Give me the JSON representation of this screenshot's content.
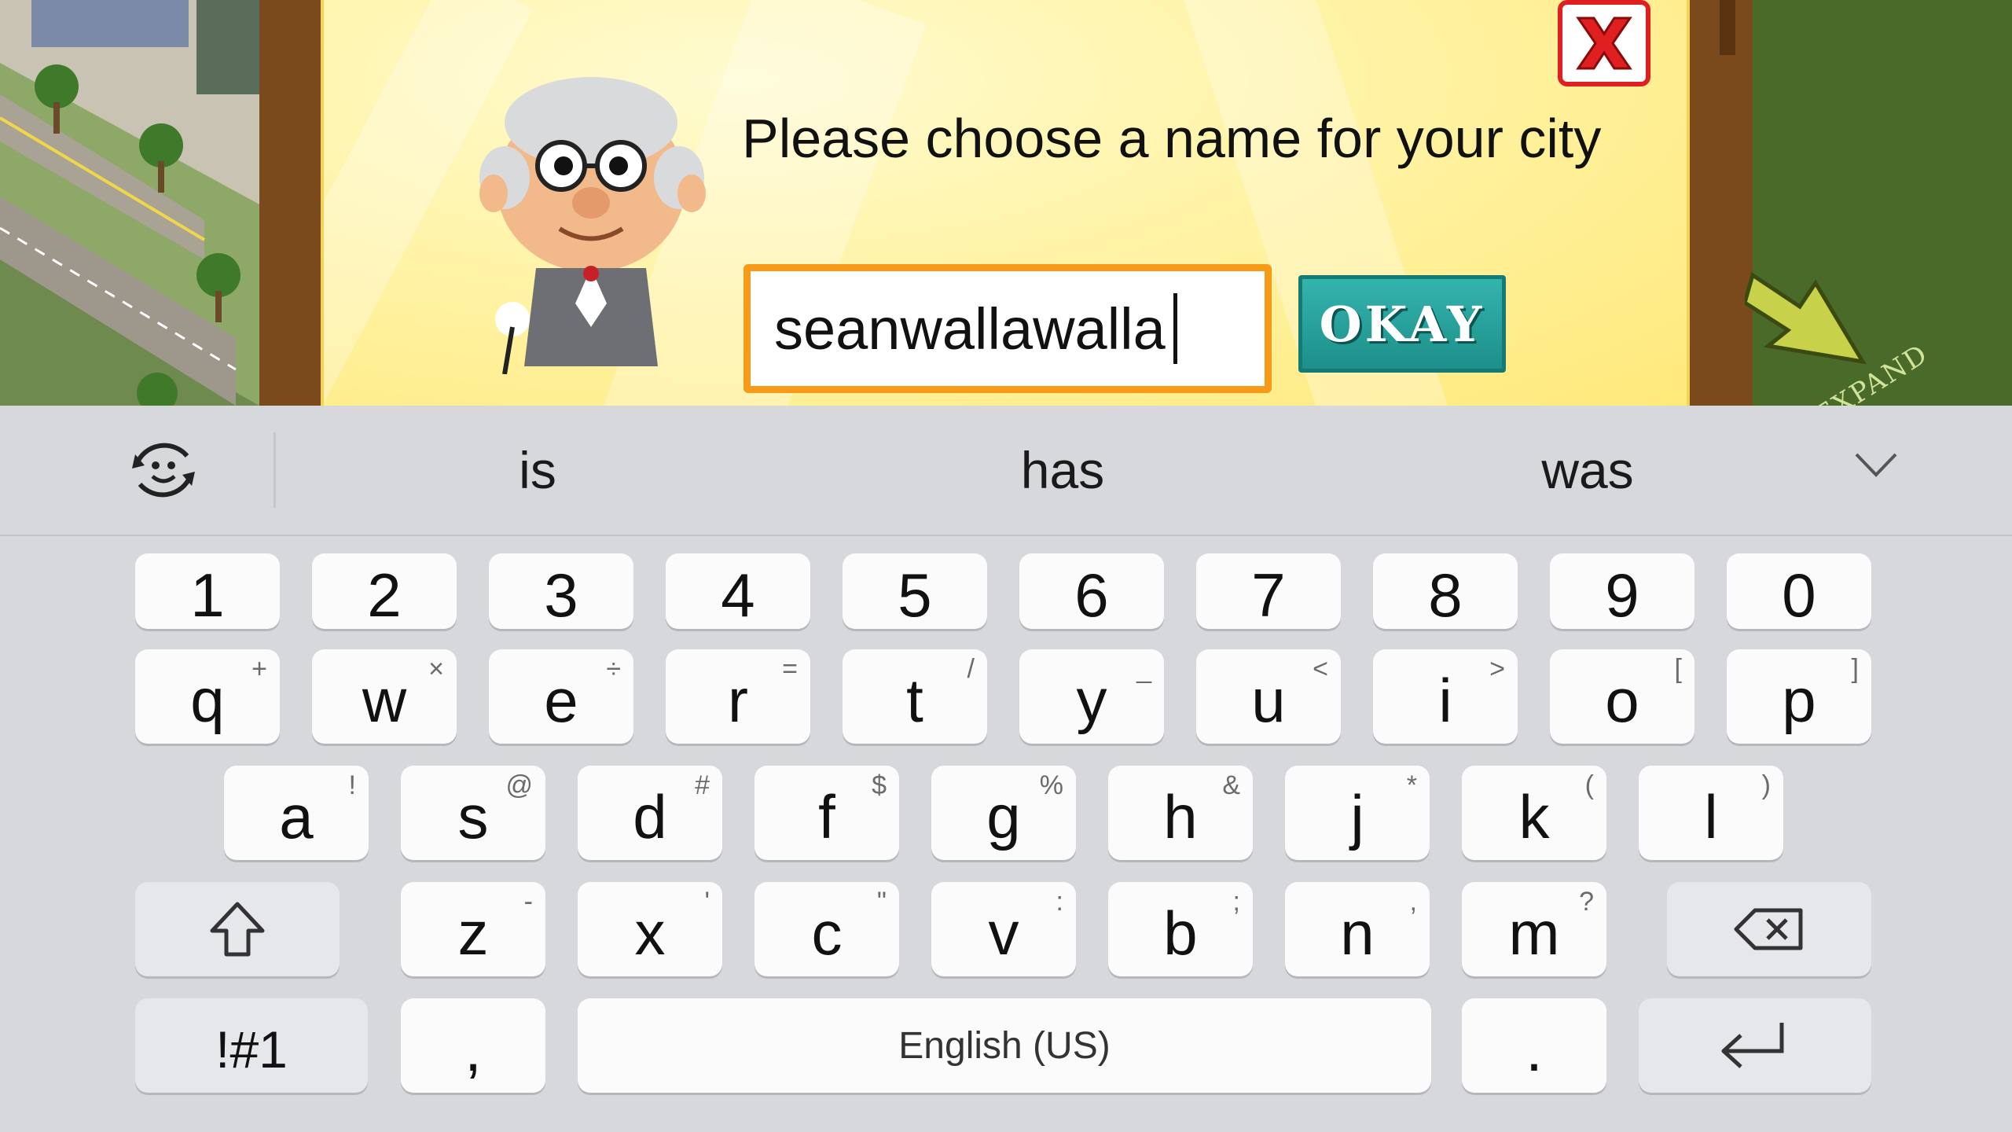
{
  "dialog": {
    "title": "Please choose a name for your city",
    "name_value": "seanwallawalla",
    "okay_label": "OKAY"
  },
  "game": {
    "expand_label": "EXPAND"
  },
  "keyboard": {
    "suggestions": [
      "is",
      "has",
      "was"
    ],
    "number_row": [
      "1",
      "2",
      "3",
      "4",
      "5",
      "6",
      "7",
      "8",
      "9",
      "0"
    ],
    "row1": [
      {
        "key": "q",
        "hint": "+"
      },
      {
        "key": "w",
        "hint": "×"
      },
      {
        "key": "e",
        "hint": "÷"
      },
      {
        "key": "r",
        "hint": "="
      },
      {
        "key": "t",
        "hint": "/"
      },
      {
        "key": "y",
        "hint": "_"
      },
      {
        "key": "u",
        "hint": "<"
      },
      {
        "key": "i",
        "hint": ">"
      },
      {
        "key": "o",
        "hint": "["
      },
      {
        "key": "p",
        "hint": "]"
      }
    ],
    "row2": [
      {
        "key": "a",
        "hint": "!"
      },
      {
        "key": "s",
        "hint": "@"
      },
      {
        "key": "d",
        "hint": "#"
      },
      {
        "key": "f",
        "hint": "$"
      },
      {
        "key": "g",
        "hint": "%"
      },
      {
        "key": "h",
        "hint": "&"
      },
      {
        "key": "j",
        "hint": "*"
      },
      {
        "key": "k",
        "hint": "("
      },
      {
        "key": "l",
        "hint": ")"
      }
    ],
    "row3": [
      {
        "key": "z",
        "hint": "-"
      },
      {
        "key": "x",
        "hint": "'"
      },
      {
        "key": "c",
        "hint": "\""
      },
      {
        "key": "v",
        "hint": ":"
      },
      {
        "key": "b",
        "hint": ";"
      },
      {
        "key": "n",
        "hint": ","
      },
      {
        "key": "m",
        "hint": "?"
      }
    ],
    "symbols_label": "!#1",
    "comma_label": ",",
    "space_label": "English (US)",
    "period_label": "."
  },
  "colors": {
    "popup_yellow": "#fff3a6",
    "input_border": "#f79a17",
    "okay_teal": "#1d8f8a",
    "close_red": "#e02020",
    "keyboard_bg": "#d6d8dc"
  }
}
